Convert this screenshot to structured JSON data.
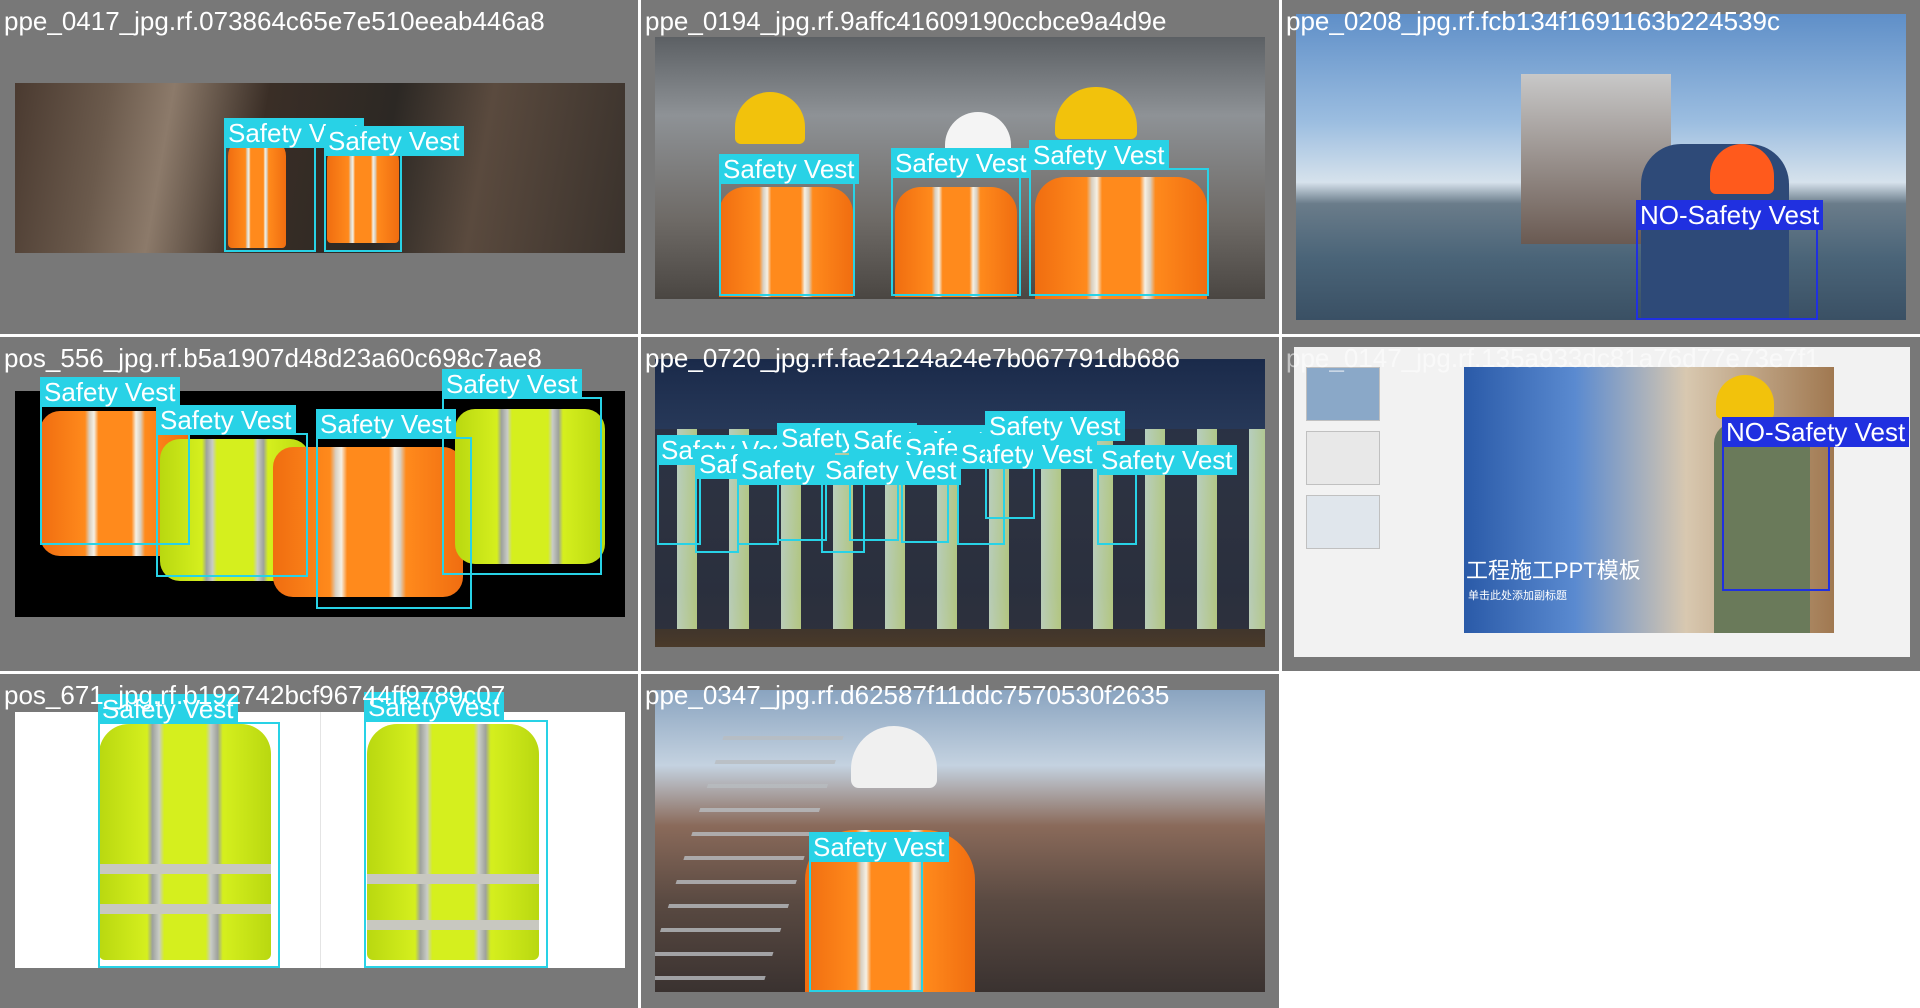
{
  "colors": {
    "tile_bg": "#787878",
    "vest_label": "#28d2e6",
    "no_vest_label": "#2030e0",
    "title_text": "#ffffff"
  },
  "tiles": [
    {
      "title": "ppe_0417_jpg.rf.073864c65e7e510eeab446a8",
      "labels": [
        "Safety Vest",
        "Safety Vest"
      ]
    },
    {
      "title": "ppe_0194_jpg.rf.9affc41609190ccbce9a4d9e",
      "labels": [
        "Safety Vest",
        "Safety Vest",
        "Safety Vest"
      ]
    },
    {
      "title": "ppe_0208_jpg.rf.fcb134f1691163b224539c",
      "labels": [
        "NO-Safety Vest"
      ]
    },
    {
      "title": "pos_556_jpg.rf.b5a1907d48d23a60c698c7ae8",
      "labels": [
        "Safety Vest",
        "Safety Vest",
        "Safety Vest",
        "Safety Vest"
      ]
    },
    {
      "title": "ppe_0720_jpg.rf.fae2124a24e7b067791db686",
      "labels": [
        "Safety Vest",
        "Safety Vest",
        "Safety Vest",
        "Safety Vest",
        "Safety Vest",
        "Safety Vest",
        "Safety Vest",
        "Safety Vest",
        "Safety Vest",
        "Safety Vest"
      ]
    },
    {
      "title": "ppe_0147_jpg.rf.135a933dc81a76d77e73e7f1",
      "labels": [
        "NO-Safety Vest"
      ],
      "slide_title": "工程施工PPT模板",
      "slide_subtitle": "单击此处添加副标题"
    },
    {
      "title": "pos_671_jpg.rf.b192742bcf96744ff9789c07",
      "labels": [
        "Safety Vest",
        "Safety Vest"
      ]
    },
    {
      "title": "ppe_0347_jpg.rf.d62587f11ddc7570530f2635",
      "labels": [
        "Safety Vest"
      ]
    }
  ]
}
